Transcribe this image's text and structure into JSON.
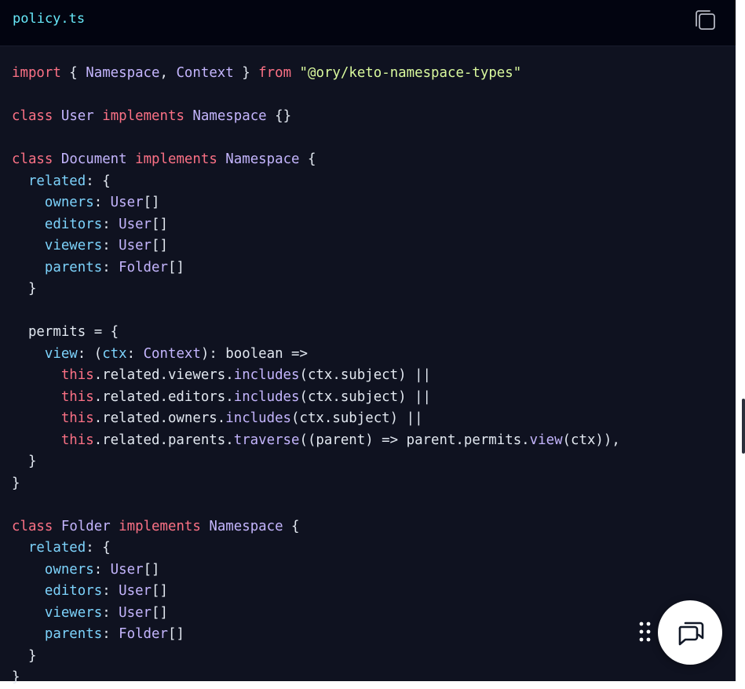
{
  "header": {
    "file_name": "policy.ts"
  },
  "code": {
    "lines": [
      [
        [
          "kw",
          "import"
        ],
        [
          "plain",
          " { "
        ],
        [
          "type",
          "Namespace"
        ],
        [
          "plain",
          ", "
        ],
        [
          "type",
          "Context"
        ],
        [
          "plain",
          " } "
        ],
        [
          "kw",
          "from"
        ],
        [
          "plain",
          " "
        ],
        [
          "str",
          "\"@ory/keto-namespace-types\""
        ]
      ],
      [],
      [
        [
          "kw",
          "class"
        ],
        [
          "plain",
          " "
        ],
        [
          "type",
          "User"
        ],
        [
          "plain",
          " "
        ],
        [
          "kw",
          "implements"
        ],
        [
          "plain",
          " "
        ],
        [
          "type",
          "Namespace"
        ],
        [
          "plain",
          " {}"
        ]
      ],
      [],
      [
        [
          "kw",
          "class"
        ],
        [
          "plain",
          " "
        ],
        [
          "type",
          "Document"
        ],
        [
          "plain",
          " "
        ],
        [
          "kw",
          "implements"
        ],
        [
          "plain",
          " "
        ],
        [
          "type",
          "Namespace"
        ],
        [
          "plain",
          " {"
        ]
      ],
      [
        [
          "plain",
          "  "
        ],
        [
          "prop",
          "related"
        ],
        [
          "plain",
          ": {"
        ]
      ],
      [
        [
          "plain",
          "    "
        ],
        [
          "prop",
          "owners"
        ],
        [
          "plain",
          ": "
        ],
        [
          "type",
          "User"
        ],
        [
          "plain",
          "[]"
        ]
      ],
      [
        [
          "plain",
          "    "
        ],
        [
          "prop",
          "editors"
        ],
        [
          "plain",
          ": "
        ],
        [
          "type",
          "User"
        ],
        [
          "plain",
          "[]"
        ]
      ],
      [
        [
          "plain",
          "    "
        ],
        [
          "prop",
          "viewers"
        ],
        [
          "plain",
          ": "
        ],
        [
          "type",
          "User"
        ],
        [
          "plain",
          "[]"
        ]
      ],
      [
        [
          "plain",
          "    "
        ],
        [
          "prop",
          "parents"
        ],
        [
          "plain",
          ": "
        ],
        [
          "type",
          "Folder"
        ],
        [
          "plain",
          "[]"
        ]
      ],
      [
        [
          "plain",
          "  }"
        ]
      ],
      [],
      [
        [
          "plain",
          "  permits = {"
        ]
      ],
      [
        [
          "plain",
          "    "
        ],
        [
          "prop",
          "view"
        ],
        [
          "plain",
          ": ("
        ],
        [
          "prop",
          "ctx"
        ],
        [
          "plain",
          ": "
        ],
        [
          "type",
          "Context"
        ],
        [
          "plain",
          "): boolean =>"
        ]
      ],
      [
        [
          "plain",
          "      "
        ],
        [
          "kw",
          "this"
        ],
        [
          "plain",
          ".related.viewers."
        ],
        [
          "func",
          "includes"
        ],
        [
          "plain",
          "(ctx.subject) ||"
        ]
      ],
      [
        [
          "plain",
          "      "
        ],
        [
          "kw",
          "this"
        ],
        [
          "plain",
          ".related.editors."
        ],
        [
          "func",
          "includes"
        ],
        [
          "plain",
          "(ctx.subject) ||"
        ]
      ],
      [
        [
          "plain",
          "      "
        ],
        [
          "kw",
          "this"
        ],
        [
          "plain",
          ".related.owners."
        ],
        [
          "func",
          "includes"
        ],
        [
          "plain",
          "(ctx.subject) ||"
        ]
      ],
      [
        [
          "plain",
          "      "
        ],
        [
          "kw",
          "this"
        ],
        [
          "plain",
          ".related.parents."
        ],
        [
          "func",
          "traverse"
        ],
        [
          "plain",
          "((parent) => parent.permits."
        ],
        [
          "func",
          "view"
        ],
        [
          "plain",
          "(ctx)),"
        ]
      ],
      [
        [
          "plain",
          "  }"
        ]
      ],
      [
        [
          "plain",
          "}"
        ]
      ],
      [],
      [
        [
          "kw",
          "class"
        ],
        [
          "plain",
          " "
        ],
        [
          "type",
          "Folder"
        ],
        [
          "plain",
          " "
        ],
        [
          "kw",
          "implements"
        ],
        [
          "plain",
          " "
        ],
        [
          "type",
          "Namespace"
        ],
        [
          "plain",
          " {"
        ]
      ],
      [
        [
          "plain",
          "  "
        ],
        [
          "prop",
          "related"
        ],
        [
          "plain",
          ": {"
        ]
      ],
      [
        [
          "plain",
          "    "
        ],
        [
          "prop",
          "owners"
        ],
        [
          "plain",
          ": "
        ],
        [
          "type",
          "User"
        ],
        [
          "plain",
          "[]"
        ]
      ],
      [
        [
          "plain",
          "    "
        ],
        [
          "prop",
          "editors"
        ],
        [
          "plain",
          ": "
        ],
        [
          "type",
          "User"
        ],
        [
          "plain",
          "[]"
        ]
      ],
      [
        [
          "plain",
          "    "
        ],
        [
          "prop",
          "viewers"
        ],
        [
          "plain",
          ": "
        ],
        [
          "type",
          "User"
        ],
        [
          "plain",
          "[]"
        ]
      ],
      [
        [
          "plain",
          "    "
        ],
        [
          "prop",
          "parents"
        ],
        [
          "plain",
          ": "
        ],
        [
          "type",
          "Folder"
        ],
        [
          "plain",
          "[]"
        ]
      ],
      [
        [
          "plain",
          "  }"
        ]
      ],
      [
        [
          "plain",
          "}"
        ]
      ]
    ]
  },
  "icons": {
    "copy": "copy-icon",
    "drag": "drag-handle-icon",
    "chat": "chat-bubbles-icon"
  },
  "colors": {
    "background": "#0f1220",
    "header_background": "#020410",
    "file_name": "#67e8f9",
    "keyword": "#fb7185",
    "type": "#c4b5fd",
    "property": "#7dd3fc",
    "string": "#d9f99d",
    "plain": "#e2e8f0"
  }
}
